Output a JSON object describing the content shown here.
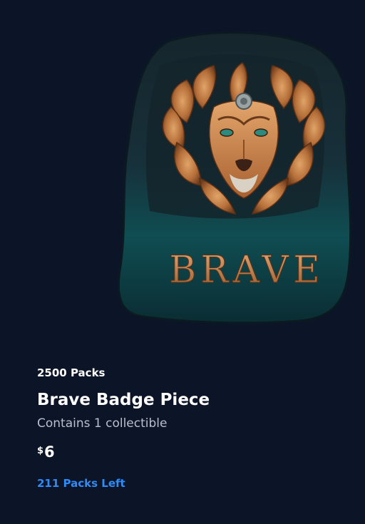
{
  "card": {
    "pack_count": "2500 Packs",
    "title": "Brave Badge Piece",
    "subtitle": "Contains 1 collectible",
    "price_currency": "$",
    "price_amount": "6",
    "packs_left": "211 Packs Left"
  },
  "artwork": {
    "image_name": "lion-badge-image",
    "badge_word": "BRAVE"
  },
  "colors": {
    "background": "#0c1428",
    "accent": "#2f8bf5",
    "subtitle": "#b9bfcb",
    "badge_teal": "#0f4a4e",
    "badge_dark": "#16262d",
    "lion_copper": "#c8824a"
  }
}
